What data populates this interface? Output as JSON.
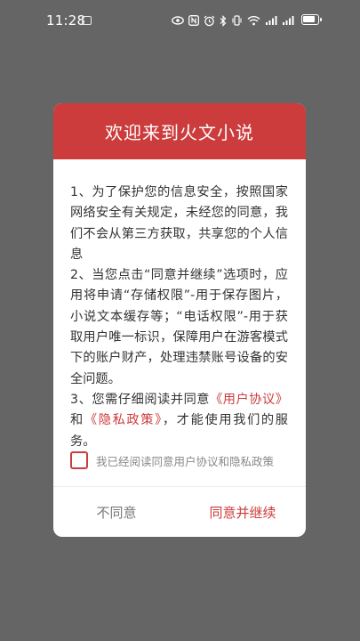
{
  "status_bar": {
    "time": "11:28",
    "battery": "battery-full"
  },
  "dialog": {
    "title": "欢迎来到火文小说",
    "paragraph1": "1、为了保护您的信息安全，按照国家网络安全有关规定，未经您的同意，我们不会从第三方获取，共享您的个人信息",
    "paragraph2": "2、当您点击“同意并继续”选项时，应用将申请“存储权限”-用于保存图片，小说文本缓存等；“电话权限”-用于获取用户唯一标识，保障用户在游客模式下的账户财产，处理违禁账号设备的安全问题。",
    "paragraph3": {
      "prefix": "3、您需仔细阅读并同意",
      "user_agreement_link": "《用户协议》",
      "and": "和",
      "privacy_policy_link": "《隐私政策》",
      "suffix": "，才能使用我们的服务。"
    },
    "agree_checkbox_label": "我已经阅读同意用户协议和隐私政策",
    "disagree_button": "不同意",
    "agree_continue_button": "同意并继续"
  },
  "colors": {
    "accent": "#cc3c3c",
    "overlay": "#656565"
  }
}
